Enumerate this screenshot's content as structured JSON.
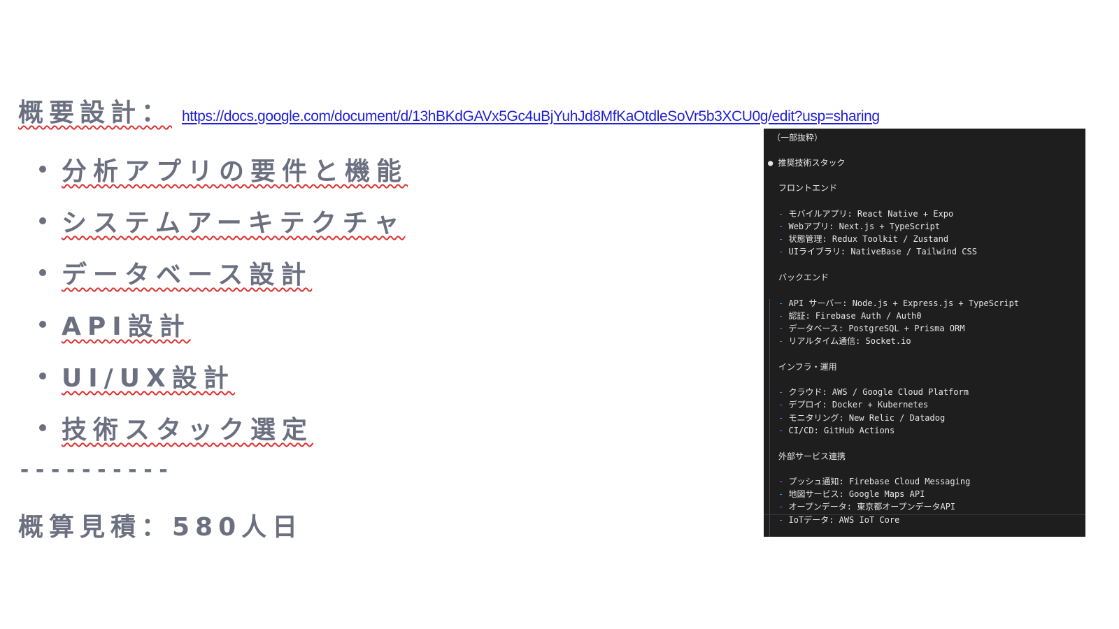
{
  "heading": {
    "label": "概要設計：",
    "url": "https://docs.google.com/document/d/13hBKdGAVx5Gc4uBjYuhJd8MfKaOtdleSoVr5b3XCU0g/edit?usp=sharing"
  },
  "bullets": [
    "分析アプリの要件と機能",
    "システムアーキテクチャ",
    "データベース設計",
    "API設計",
    "UI/UX設計",
    "技術スタック選定"
  ],
  "divider": "----------",
  "estimate": "概算見積：580人日",
  "panel": {
    "excerpt_note": "（一部抜粋）",
    "section_title": "推奨技術スタック",
    "groups": [
      {
        "title": "フロントエンド",
        "items": [
          "モバイルアプリ: React Native + Expo",
          "Webアプリ: Next.js + TypeScript",
          "状態管理: Redux Toolkit / Zustand",
          "UIライブラリ: NativeBase / Tailwind CSS"
        ]
      },
      {
        "title": "バックエンド",
        "items": [
          "API サーバー: Node.js + Express.js + TypeScript",
          "認証: Firebase Auth / Auth0",
          "データベース: PostgreSQL + Prisma ORM",
          "リアルタイム通信: Socket.io"
        ]
      },
      {
        "title": "インフラ・運用",
        "items": [
          "クラウド: AWS / Google Cloud Platform",
          "デプロイ: Docker + Kubernetes",
          "モニタリング: New Relic / Datadog",
          "CI/CD: GitHub Actions"
        ]
      },
      {
        "title": "外部サービス連携",
        "items": [
          "プッシュ通知: Firebase Cloud Messaging",
          "地図サービス: Google Maps API",
          "オープンデータ: 東京都オープンデータAPI",
          "IoTデータ: AWS IoT Core"
        ]
      }
    ]
  },
  "colors": {
    "slide_text": "#6b6f80",
    "link": "#1f1fd6",
    "spellcheck": "#e03030",
    "panel_bg": "#1e1e1e",
    "panel_dash": "#4c8fe8"
  }
}
